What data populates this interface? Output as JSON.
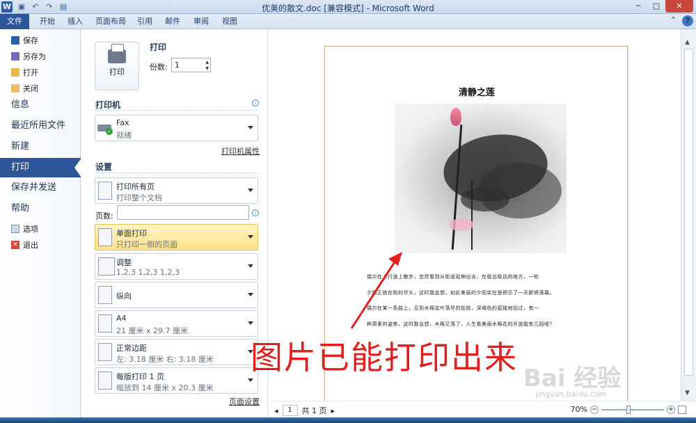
{
  "window": {
    "title": "优美的散文.doc [兼容模式] - Microsoft Word",
    "app_logo": "W",
    "controls": [
      "─",
      "□",
      "✕"
    ]
  },
  "ribbon": {
    "tabs": [
      "文件",
      "开始",
      "插入",
      "页面布局",
      "引用",
      "邮件",
      "审阅",
      "视图"
    ],
    "help": "?"
  },
  "nav": {
    "small_top": [
      {
        "label": "保存",
        "icon": "save-icon"
      },
      {
        "label": "另存为",
        "icon": "save-as-icon"
      },
      {
        "label": "打开",
        "icon": "open-folder-icon"
      },
      {
        "label": "关闭",
        "icon": "close-folder-icon"
      }
    ],
    "big": [
      "信息",
      "最近所用文件",
      "新建",
      "打印",
      "保存并发送",
      "帮助"
    ],
    "active": "打印",
    "small_bottom": [
      {
        "label": "选项",
        "icon": "options-icon"
      },
      {
        "label": "退出",
        "icon": "exit-icon"
      }
    ]
  },
  "print": {
    "heading": "打印",
    "button_label": "打印",
    "copies_label": "份数:",
    "copies_value": "1",
    "printer_heading": "打印机",
    "printer_name": "Fax",
    "printer_status": "就绪",
    "printer_props_link": "打印机属性",
    "settings_heading": "设置",
    "pages_label": "页数:",
    "pages_value": "",
    "page_setup_link": "页面设置",
    "settings": [
      {
        "title": "打印所有页",
        "sub": "打印整个文档"
      },
      {
        "title": "单面打印",
        "sub": "只打印一侧的页面"
      },
      {
        "title": "调整",
        "sub": "1,2,3    1,2,3    1,2,3"
      },
      {
        "title": "纵向",
        "sub": ""
      },
      {
        "title": "A4",
        "sub": "21 厘米 x 29.7 厘米"
      },
      {
        "title": "正常边距",
        "sub": "左:  3.18 厘米    右:  3.18 厘米"
      },
      {
        "title": "每版打印 1 页",
        "sub": "缩放到 14 厘米 x 20.3 厘米"
      }
    ]
  },
  "document": {
    "title": "清静之莲",
    "paragraph_lines": [
      "偶尔在人行道上散步，忽然看到从街道延伸出去，在极远极远的地方，一轮",
      "夕阳正挂在街的尽头，这时我会想，如此美丽的夕阳实在是预示了一天即将落幕。",
      "偶尔在某一条路上，见到木棉花叶落尽的枯枝，深褐色的孤独地站过，有一",
      "种肃素的姿势，这时我会想，木棉又落了，人生看美丽木棉花的开放能有几回呢？"
    ]
  },
  "annotation": {
    "text": "图片已能打印出来",
    "color": "#e02020"
  },
  "watermark": {
    "text": "Bai 经验",
    "url_text": "jingyan.baidu.com"
  },
  "statusbar": {
    "page_current": "1",
    "page_total": "共 1 页",
    "zoom": "70%"
  },
  "colors": {
    "accent": "#2b579a",
    "selected_setting": "#fde28a"
  }
}
